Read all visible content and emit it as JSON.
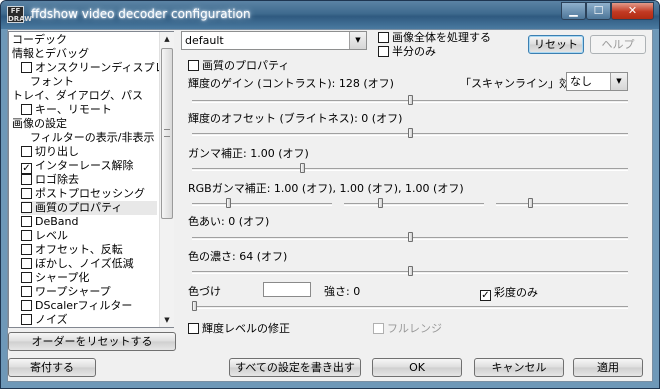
{
  "window": {
    "title": "ffdshow video decoder configuration",
    "icon_text": "FF DRAW"
  },
  "tree": {
    "items": [
      {
        "label": "コーデック",
        "indent": 0,
        "checkbox": false
      },
      {
        "label": "情報とデバッグ",
        "indent": 0,
        "checkbox": false
      },
      {
        "label": "オンスクリーンディスプレイ",
        "indent": 1,
        "checkbox": true,
        "checked": false
      },
      {
        "label": "フォント",
        "indent": 2,
        "checkbox": false
      },
      {
        "label": "トレイ、ダイアログ、パス",
        "indent": 0,
        "checkbox": false
      },
      {
        "label": "キー、リモート",
        "indent": 1,
        "checkbox": true,
        "checked": false
      },
      {
        "label": "画像の設定",
        "indent": 0,
        "checkbox": false
      },
      {
        "label": "フィルターの表示/非表示",
        "indent": 2,
        "checkbox": false
      },
      {
        "label": "切り出し",
        "indent": 1,
        "checkbox": true,
        "checked": false
      },
      {
        "label": "インターレース解除",
        "indent": 1,
        "checkbox": true,
        "checked": true
      },
      {
        "label": "ロゴ除去",
        "indent": 1,
        "checkbox": true,
        "checked": false
      },
      {
        "label": "ポストプロセッシング",
        "indent": 1,
        "checkbox": true,
        "checked": false
      },
      {
        "label": "画質のプロパティ",
        "indent": 1,
        "checkbox": true,
        "checked": false,
        "selected": true
      },
      {
        "label": "DeBand",
        "indent": 1,
        "checkbox": true,
        "checked": false
      },
      {
        "label": "レベル",
        "indent": 1,
        "checkbox": true,
        "checked": false
      },
      {
        "label": "オフセット、反転",
        "indent": 1,
        "checkbox": true,
        "checked": false
      },
      {
        "label": "ぼかし、ノイズ低減",
        "indent": 1,
        "checkbox": true,
        "checked": false
      },
      {
        "label": "シャープ化",
        "indent": 1,
        "checkbox": true,
        "checked": false
      },
      {
        "label": "ワープシャープ",
        "indent": 1,
        "checkbox": true,
        "checked": false
      },
      {
        "label": "DScalerフィルター",
        "indent": 1,
        "checkbox": true,
        "checked": false
      },
      {
        "label": "ノイズ",
        "indent": 1,
        "checkbox": true,
        "checked": false
      }
    ]
  },
  "preset": {
    "value": "default"
  },
  "options": {
    "process_whole_image": "画像全体を処理する",
    "half_only": "半分のみ"
  },
  "buttons": {
    "reset": "リセット",
    "help": "ヘルプ",
    "reset_order": "オーダーをリセットする",
    "donate": "寄付する",
    "write_all": "すべての設定を書き出す",
    "ok": "OK",
    "cancel": "キャンセル",
    "apply": "適用"
  },
  "filter": {
    "enable_label": "画質のプロパティ",
    "gain_label": "輝度のゲイン (コントラスト): 128 (オフ)",
    "gain_level": 0.5,
    "scanline_label": "「スキャンライン」効果",
    "scanline_value": "なし",
    "offset_label": "輝度のオフセット (ブライトネス): 0 (オフ)",
    "offset_level": 0.5,
    "gamma_label": "ガンマ補正: 1.00 (オフ)",
    "gamma_level": 0.25,
    "rgb_gamma_label": "RGBガンマ補正: 1.00 (オフ), 1.00 (オフ), 1.00 (オフ)",
    "rgb_gamma_levels": [
      0.25,
      0.25,
      0.25
    ],
    "hue_label": "色あい: 0 (オフ)",
    "hue_level": 0.5,
    "saturation_label": "色の濃さ: 64 (オフ)",
    "saturation_level": 0.5,
    "colorize_label": "色づけ",
    "colorize_color": "#ffffff",
    "strength_label": "強さ: 0",
    "strength_level": 0.0,
    "chroma_only_label": "彩度のみ",
    "chroma_only_checked": true,
    "luma_level_fix_label": "輝度レベルの修正",
    "full_range_label": "フルレンジ"
  }
}
